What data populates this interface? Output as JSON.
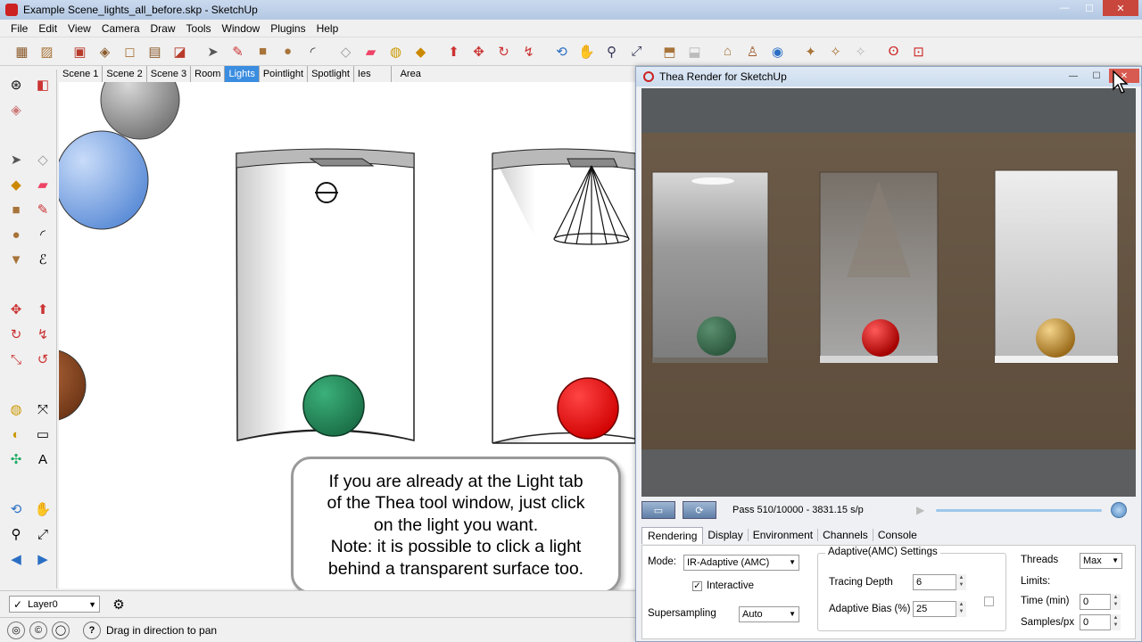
{
  "window": {
    "title": "Example Scene_lights_all_before.skp - SketchUp",
    "min": "—",
    "max": "☐",
    "close": "✕"
  },
  "menu": [
    "File",
    "Edit",
    "View",
    "Camera",
    "Draw",
    "Tools",
    "Window",
    "Plugins",
    "Help"
  ],
  "scenes": [
    "Scene 1",
    "Scene 2",
    "Scene 3",
    "Room",
    "Lights",
    "Pointlight",
    "Spotlight",
    "Ies",
    "Area"
  ],
  "active_scene_index": 4,
  "callout": {
    "lines": [
      "If you are already at the Light tab",
      "of the Thea tool window, just click",
      "on the light you want.",
      "Note: it is possible to click a light",
      "behind a transparent surface too."
    ]
  },
  "layer": {
    "value": "Layer0",
    "check": "✓",
    "arrow": "▼"
  },
  "status": {
    "message": "Drag in direction to pan",
    "help": "?"
  },
  "thea": {
    "title": "Thea Render for SketchUp",
    "pass": "Pass 510/10000 - 3831.15 s/p",
    "tabs": [
      "Rendering",
      "Display",
      "Environment",
      "Channels",
      "Console"
    ],
    "active_tab_index": 0,
    "mode_label": "Mode:",
    "mode_value": "IR-Adaptive (AMC)",
    "interactive_label": "Interactive",
    "interactive_checked": "✓",
    "supersampling_label": "Supersampling",
    "supersampling_value": "Auto",
    "adaptive_title": "Adaptive(AMC) Settings",
    "tracing_depth_label": "Tracing Depth",
    "tracing_depth_value": "6",
    "adaptive_bias_label": "Adaptive Bias (%)",
    "adaptive_bias_value": "25",
    "threads_label": "Threads",
    "threads_value": "Max",
    "limits_label": "Limits:",
    "time_label": "Time (min)",
    "time_value": "0",
    "samples_label": "Samples/px",
    "samples_value": "0",
    "slider_progress": 0.051
  },
  "colors": {
    "active_tab": "#3a8de0",
    "green_ball": "#2a8a5c",
    "red_ball": "#ee1111",
    "blue_sphere": "#7fa9e8"
  }
}
